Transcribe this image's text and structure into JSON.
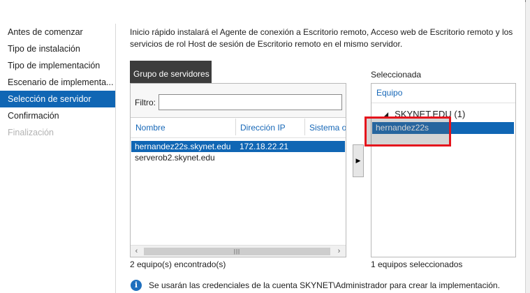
{
  "nav": {
    "items": [
      {
        "label": "Antes de comenzar",
        "state": "normal"
      },
      {
        "label": "Tipo de instalación",
        "state": "normal"
      },
      {
        "label": "Tipo de implementación",
        "state": "normal"
      },
      {
        "label": "Escenario de implementa...",
        "state": "normal"
      },
      {
        "label": "Selección de servidor",
        "state": "active"
      },
      {
        "label": "Confirmación",
        "state": "normal"
      },
      {
        "label": "Finalización",
        "state": "disabled"
      }
    ]
  },
  "intro": "Inicio rápido instalará el Agente de conexión a Escritorio remoto, Acceso web de Escritorio remoto y los servicios de rol Host de sesión de Escritorio remoto en el mismo servidor.",
  "server_pool": {
    "tab_label": "Grupo de servidores",
    "filter_label": "Filtro:",
    "filter_value": "",
    "columns": [
      "Nombre",
      "Dirección IP",
      "Sistema o"
    ],
    "rows": [
      {
        "name": "hernandez22s.skynet.edu",
        "ip": "172.18.22.21",
        "selected": true
      },
      {
        "name": "serverob2.skynet.edu",
        "ip": "",
        "selected": false
      }
    ],
    "scroll_left_icon": "chevron-left-icon",
    "scroll_right_icon": "chevron-right-icon",
    "count_text": "2 equipo(s) encontrado(s)"
  },
  "add_button_icon": "arrow-right-icon",
  "selected": {
    "title": "Seleccionada",
    "column": "Equipo",
    "group": "SKYNET.EDU (1)",
    "items": [
      "hernandez22s"
    ],
    "count_text": "1 equipos seleccionados"
  },
  "info": {
    "icon": "info-icon",
    "text": "Se usarán las credenciales de la cuenta SKYNET\\Administrador para crear la implementación."
  },
  "colors": {
    "selection": "#1066b4",
    "header_text": "#1667b7",
    "tab_bg": "#3c3c3c",
    "annotation": "#e5141c"
  }
}
